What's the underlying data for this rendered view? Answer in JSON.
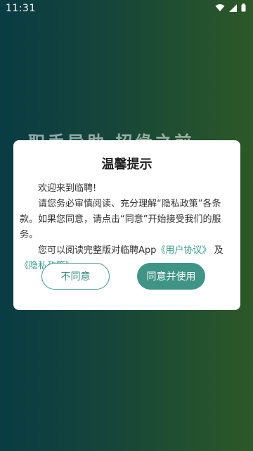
{
  "status_bar": {
    "time": "11:31"
  },
  "background": {
    "slogan": "职手导助 招缘之前"
  },
  "dialog": {
    "title": "温馨提示",
    "welcome": "欢迎来到临聘!",
    "p2": "请您务必审慎阅读、充分理解“隐私政策”各条款。如果您同意，请点击“同意”开始接受我们的服务。",
    "p3_prefix": "您可以阅读完整版对临聘App",
    "user_agreement": "《用户协议》",
    "p3_and": "及",
    "privacy_policy": "《隐私政策》",
    "disagree_label": "不同意",
    "agree_label": "同意并使用"
  },
  "colors": {
    "accent": "#3f9486",
    "link": "#3a9a8a"
  }
}
